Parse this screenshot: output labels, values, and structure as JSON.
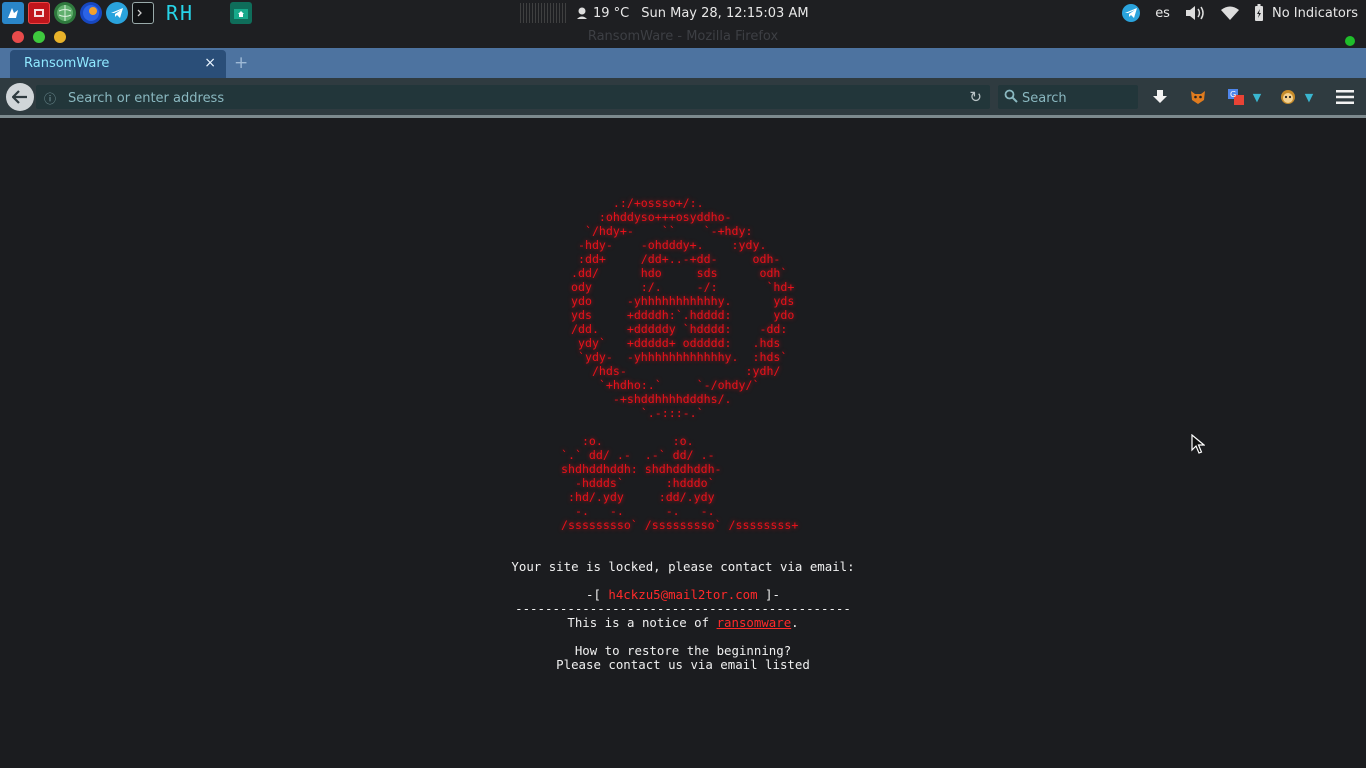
{
  "panel": {
    "launchers": [
      {
        "name": "terminal-icon",
        "glyph": "▶",
        "bg": "#1b6fb3"
      },
      {
        "name": "app-red-icon",
        "glyph": "■",
        "bg": "#c0151b"
      },
      {
        "name": "globe-icon",
        "glyph": "◍",
        "bg": "#3f9a52"
      },
      {
        "name": "browser-icon",
        "glyph": "◉",
        "bg": "#1747c0"
      },
      {
        "name": "telegram-icon",
        "glyph": "➤",
        "bg": "#2aa3dd"
      },
      {
        "name": "console-icon",
        "glyph": "▭",
        "bg": "#101214"
      }
    ],
    "rh_label": "RH",
    "weather": "19 °C",
    "datetime": "Sun May 28, 12:15:03 AM",
    "keyboard_layout": "es",
    "indicators_label": "No Indicators"
  },
  "window": {
    "title": "RansomWare - Mozilla Firefox",
    "buttons": {
      "close_color": "#e84b4b",
      "maximize_color": "#3ec93e",
      "minimize_color": "#e8b22a"
    }
  },
  "browser": {
    "tab_title": "RansomWare",
    "tab_close_glyph": "×",
    "new_tab_glyph": "+",
    "url_placeholder": "Search or enter address",
    "search_placeholder": "Search"
  },
  "page": {
    "skull_art": "      .:/+ossso+/:.\n    :ohddyso+++osyddho-\n  `/hdy+-    ``    `-+hdy:\n -hdy-    -ohdddy+.    :ydy.\n :dd+     /dd+..-+dd-     odh-\n.dd/      hdo     sds      odh`\nody       :/.     -/:       `hd+\nydo     -yhhhhhhhhhhhy.      yds\nyds     +ddddh:`.hdddd:      ydo\n/dd.    +dddddy `hdddd:    -dd:\n ydy`   +ddddd+ oddddd:   .hds\n `ydy-  -yhhhhhhhhhhhhy.  :hds`\n   /hds-                 :ydh/\n    `+hdho:.`     `-/ohdy/`\n      -+shddhhhhdddhs/.\n          `.-:::-.`",
    "signature_art": "   :o.          :o.\n`.` dd/ .-  .-` dd/ .-\nshdhddhddh: shdhddhddh-\n  -hddds`      :hdddo`\n :hd/.ydy     :dd/.ydy\n  -.   -.      -.   -.\n/sssssssso` /sssssssso` /ssssssss+",
    "locked_text": "Your site is locked, please contact via email:",
    "email_prefix": "-[ ",
    "email": "h4ckzu5@mail2tor.com",
    "email_suffix": " ]-",
    "divider": "---------------------------------------------",
    "notice_prefix": "This is a notice of ",
    "notice_link": "ransomware",
    "notice_suffix": ".",
    "restore_question": "How to restore the beginning?",
    "restore_instruction": "Please contact us via email listed"
  }
}
